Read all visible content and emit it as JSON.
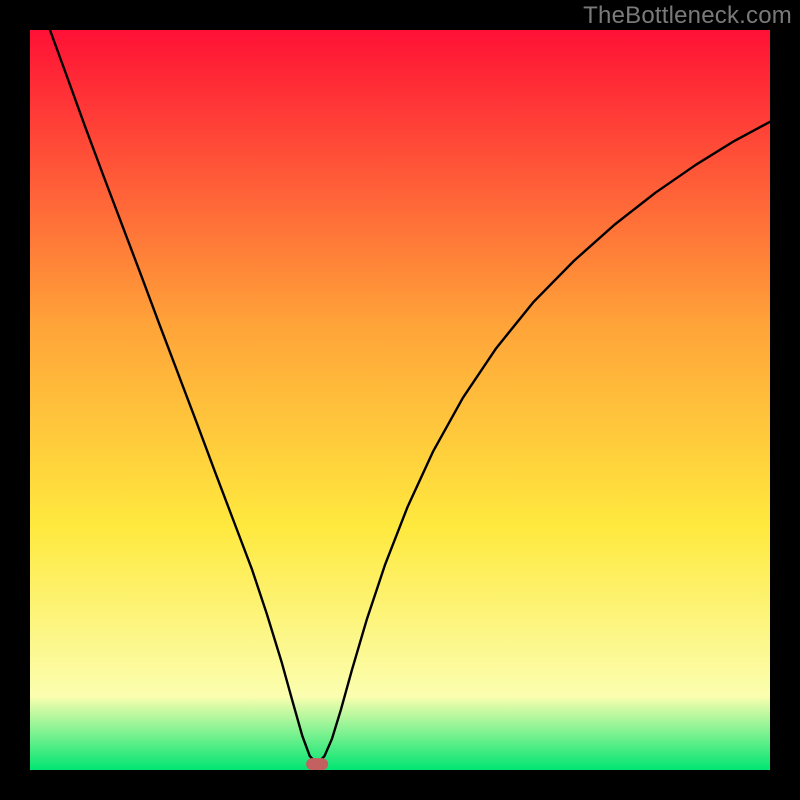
{
  "watermark": "TheBottleneck.com",
  "chart_data": {
    "type": "line",
    "title": "",
    "xlabel": "",
    "ylabel": "",
    "xlim": [
      0,
      1
    ],
    "ylim": [
      0,
      1
    ],
    "background_gradient": {
      "top": "#ff1136",
      "mid_top": "#ffa439",
      "mid": "#ffe93e",
      "mid_bottom": "#fbfeaf",
      "bottom": "#00e572"
    },
    "marker": {
      "x_frac": 0.388,
      "y_frac": 0.992,
      "color": "#c36060"
    },
    "series": [
      {
        "name": "curve",
        "color": "#000000",
        "points": [
          {
            "x_frac": 0.027,
            "y_frac": 0.0
          },
          {
            "x_frac": 0.05,
            "y_frac": 0.063
          },
          {
            "x_frac": 0.075,
            "y_frac": 0.132
          },
          {
            "x_frac": 0.1,
            "y_frac": 0.199
          },
          {
            "x_frac": 0.125,
            "y_frac": 0.265
          },
          {
            "x_frac": 0.15,
            "y_frac": 0.331
          },
          {
            "x_frac": 0.175,
            "y_frac": 0.398
          },
          {
            "x_frac": 0.2,
            "y_frac": 0.464
          },
          {
            "x_frac": 0.225,
            "y_frac": 0.53
          },
          {
            "x_frac": 0.25,
            "y_frac": 0.597
          },
          {
            "x_frac": 0.275,
            "y_frac": 0.663
          },
          {
            "x_frac": 0.3,
            "y_frac": 0.729
          },
          {
            "x_frac": 0.32,
            "y_frac": 0.789
          },
          {
            "x_frac": 0.34,
            "y_frac": 0.854
          },
          {
            "x_frac": 0.355,
            "y_frac": 0.908
          },
          {
            "x_frac": 0.368,
            "y_frac": 0.954
          },
          {
            "x_frac": 0.378,
            "y_frac": 0.981
          },
          {
            "x_frac": 0.388,
            "y_frac": 0.992
          },
          {
            "x_frac": 0.398,
            "y_frac": 0.981
          },
          {
            "x_frac": 0.408,
            "y_frac": 0.958
          },
          {
            "x_frac": 0.42,
            "y_frac": 0.919
          },
          {
            "x_frac": 0.435,
            "y_frac": 0.865
          },
          {
            "x_frac": 0.455,
            "y_frac": 0.797
          },
          {
            "x_frac": 0.48,
            "y_frac": 0.722
          },
          {
            "x_frac": 0.51,
            "y_frac": 0.645
          },
          {
            "x_frac": 0.545,
            "y_frac": 0.569
          },
          {
            "x_frac": 0.585,
            "y_frac": 0.497
          },
          {
            "x_frac": 0.63,
            "y_frac": 0.43
          },
          {
            "x_frac": 0.68,
            "y_frac": 0.368
          },
          {
            "x_frac": 0.735,
            "y_frac": 0.312
          },
          {
            "x_frac": 0.79,
            "y_frac": 0.263
          },
          {
            "x_frac": 0.845,
            "y_frac": 0.22
          },
          {
            "x_frac": 0.9,
            "y_frac": 0.182
          },
          {
            "x_frac": 0.95,
            "y_frac": 0.151
          },
          {
            "x_frac": 1.0,
            "y_frac": 0.124
          }
        ]
      }
    ]
  }
}
